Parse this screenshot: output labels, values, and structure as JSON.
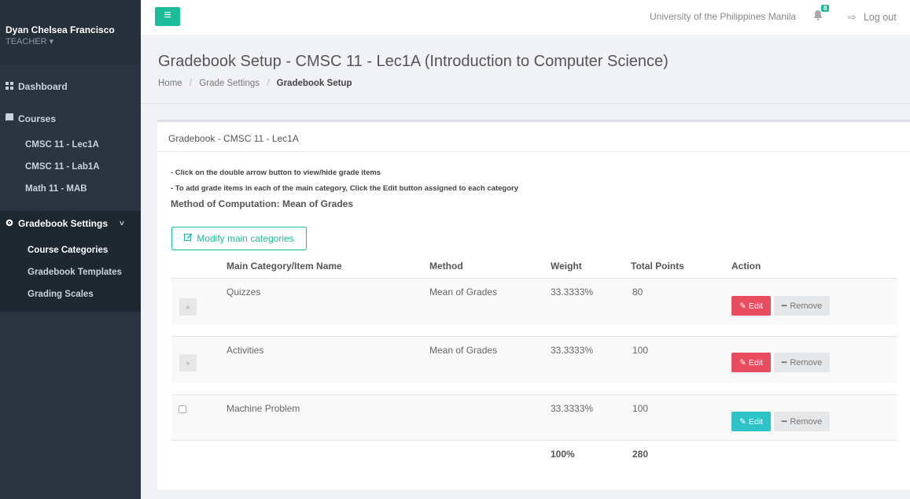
{
  "sidebar": {
    "user_name": "Dyan Chelsea Francisco",
    "user_role": "TEACHER ▾",
    "dashboard": "Dashboard",
    "courses": "Courses",
    "course_items": [
      "CMSC 11 - Lec1A",
      "CMSC 11 - Lab1A",
      "Math 11 - MAB"
    ],
    "gradebook_settings": "Gradebook Settings",
    "chevron": "˅",
    "settings_items": [
      "Course Categories",
      "Gradebook Templates",
      "Grading Scales"
    ]
  },
  "topbar": {
    "menu_icon": "≡",
    "university": "University of the Philippines Manila",
    "notification_count": "8",
    "logout": "Log out"
  },
  "header": {
    "title": "Gradebook Setup - CMSC 11 - Lec1A (Introduction to Computer Science)",
    "breadcrumb": [
      "Home",
      "Grade Settings",
      "Gradebook Setup"
    ],
    "sep": "/"
  },
  "card": {
    "title": "Gradebook - CMSC 11 - Lec1A",
    "notes": [
      "- Click on the double arrow button to view/hide grade items",
      "- To add grade items in each of the main category, Click the Edit button assigned to each category"
    ],
    "method_of_computation": "Method of Computation: Mean of Grades",
    "modify_button": "Modify main categories",
    "columns": [
      "Main Category/Item Name",
      "Method",
      "Weight",
      "Total Points",
      "Action"
    ],
    "rows": [
      {
        "name": "Quizzes",
        "method": "Mean of Grades",
        "weight": "33.3333%",
        "points": "80",
        "control": "toggle",
        "edit_color": "red"
      },
      {
        "name": "Activities",
        "method": "Mean of Grades",
        "weight": "33.3333%",
        "points": "100",
        "control": "toggle",
        "edit_color": "red"
      },
      {
        "name": "Machine Problem",
        "method": "",
        "weight": "33.3333%",
        "points": "100",
        "control": "checkbox",
        "edit_color": "teal"
      }
    ],
    "edit_label": "Edit",
    "remove_label": "Remove",
    "toggle_glyph": "»",
    "total_weight": "100%",
    "total_points": "280"
  },
  "colors": {
    "accent": "#1abc9c",
    "edit_red": "#e84c5f",
    "edit_teal": "#2ec3c9",
    "sidebar": "#2b3541"
  }
}
